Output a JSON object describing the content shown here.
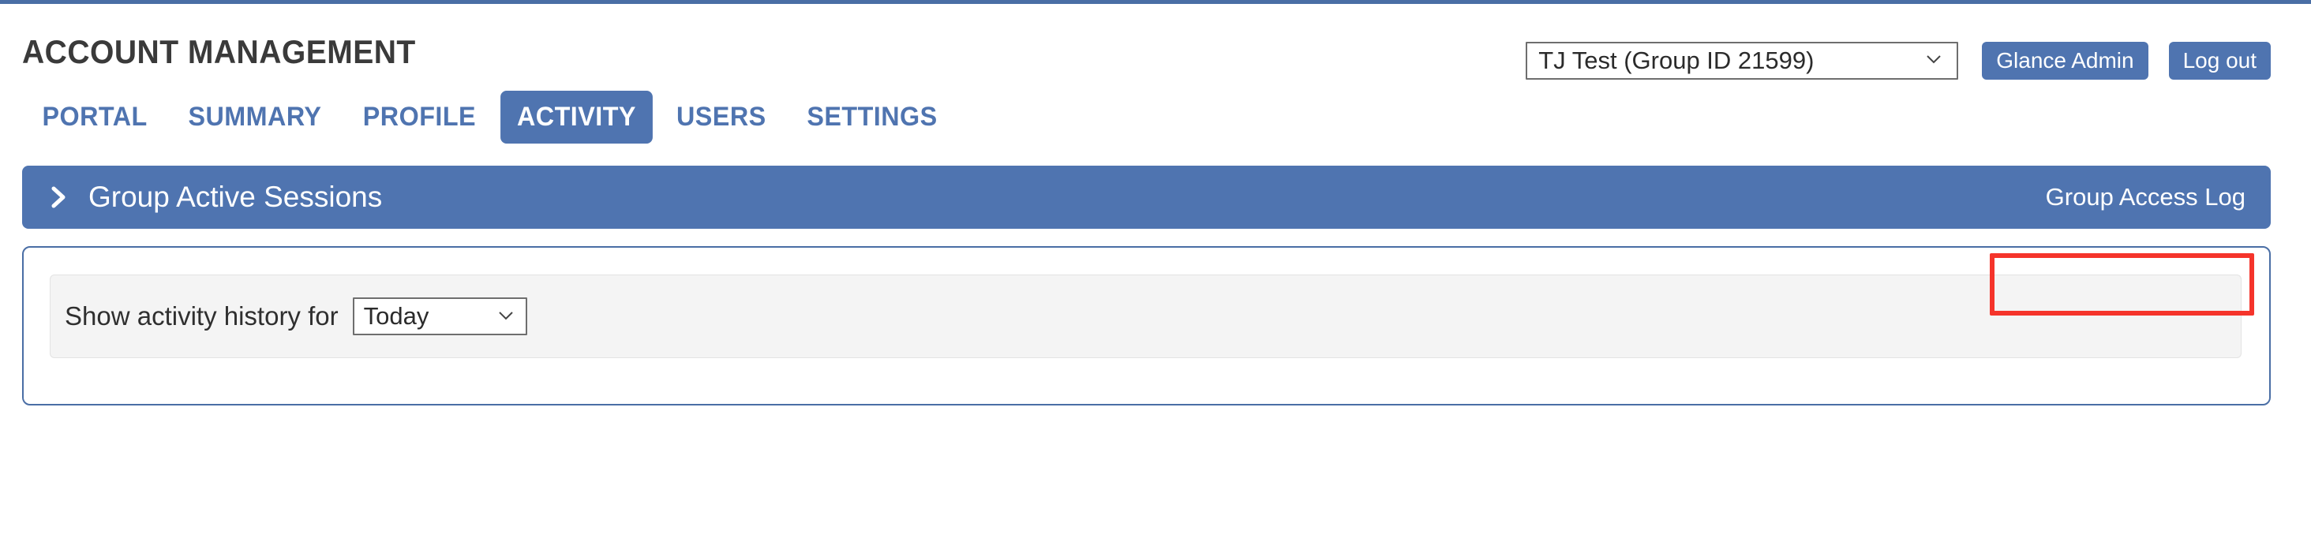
{
  "theme": {
    "accent_blue": "#4f74b0",
    "top_bar_blue": "#4a6ea5",
    "highlight_red": "#f5342b",
    "panel_gray": "#f4f4f4"
  },
  "header": {
    "title": "ACCOUNT MANAGEMENT",
    "group_select": {
      "value": "TJ Test (Group ID 21599)",
      "icon": "chevron-down-icon"
    },
    "glance_admin_label": "Glance Admin",
    "log_out_label": "Log out"
  },
  "nav": {
    "tabs": [
      {
        "label": "PORTAL",
        "active": false
      },
      {
        "label": "SUMMARY",
        "active": false
      },
      {
        "label": "PROFILE",
        "active": false
      },
      {
        "label": "ACTIVITY",
        "active": true
      },
      {
        "label": "USERS",
        "active": false
      },
      {
        "label": "SETTINGS",
        "active": false
      }
    ]
  },
  "section": {
    "expander_icon": "chevron-right-icon",
    "title": "Group Active Sessions",
    "access_log_label": "Group Access Log",
    "access_log_highlighted": true
  },
  "filter": {
    "label": "Show activity history for",
    "history_select": {
      "value": "Today",
      "icon": "chevron-down-icon"
    }
  }
}
